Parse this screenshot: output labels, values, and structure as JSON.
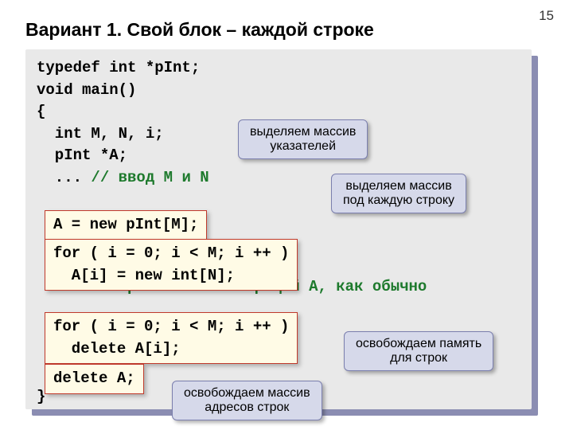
{
  "page_number": "15",
  "title": "Вариант 1. Свой блок – каждой строке",
  "code": {
    "line1": "typedef int *pInt;",
    "line2": "void main()",
    "line3": "{",
    "line4": "  int M, N, i;",
    "line5": "  pInt *A;",
    "line6a": "  ... ",
    "line6b": "// ввод M и N",
    "blank3": "\n\n\n",
    "line7a": "  ...  ",
    "line7b": "// работаем с матрицей A, как обычно",
    "blank2": "\n\n",
    "line9": "}"
  },
  "highlight1": "A = new pInt[M];",
  "highlight2": "for ( i = 0; i < M; i ++ )\n  A[i] = new int[N];",
  "highlight3": "for ( i = 0; i < M; i ++ )\n  delete A[i];",
  "highlight4": "delete A;",
  "callout1_l1": "выделяем массив",
  "callout1_l2": "указателей",
  "callout2_l1": "выделяем массив",
  "callout2_l2": "под каждую строку",
  "callout3_l1": "освобождаем память",
  "callout3_l2": "для строк",
  "callout4_l1": "освобождаем массив",
  "callout4_l2": "адресов строк"
}
